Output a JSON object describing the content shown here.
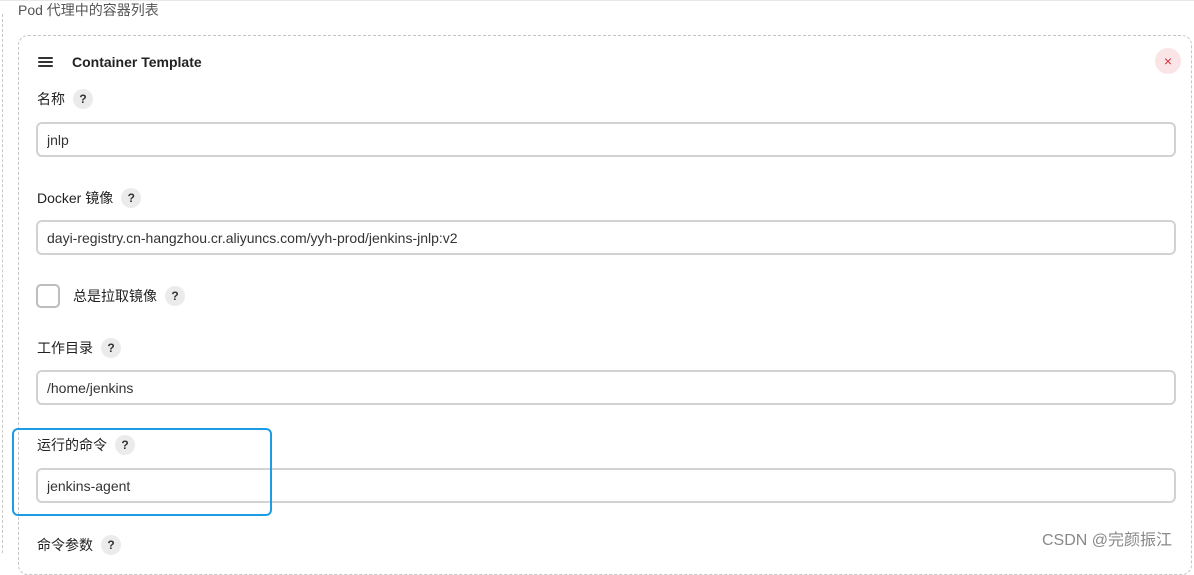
{
  "section": {
    "title": "Pod 代理中的容器列表"
  },
  "template": {
    "title": "Container Template",
    "close_label": "×"
  },
  "help_label": "?",
  "fields": {
    "name": {
      "label": "名称",
      "value": "jnlp"
    },
    "docker_image": {
      "label": "Docker 镜像",
      "value": "dayi-registry.cn-hangzhou.cr.aliyuncs.com/yyh-prod/jenkins-jnlp:v2"
    },
    "always_pull": {
      "label": "总是拉取镜像",
      "checked": false
    },
    "working_dir": {
      "label": "工作目录",
      "value": "/home/jenkins"
    },
    "command": {
      "label": "运行的命令",
      "value": "jenkins-agent"
    },
    "args": {
      "label": "命令参数"
    }
  },
  "watermark": "CSDN @完颜振江",
  "colors": {
    "highlight": "#1c9ce3",
    "close_bg": "#fbe4e6",
    "close_fg": "#d4303a"
  }
}
